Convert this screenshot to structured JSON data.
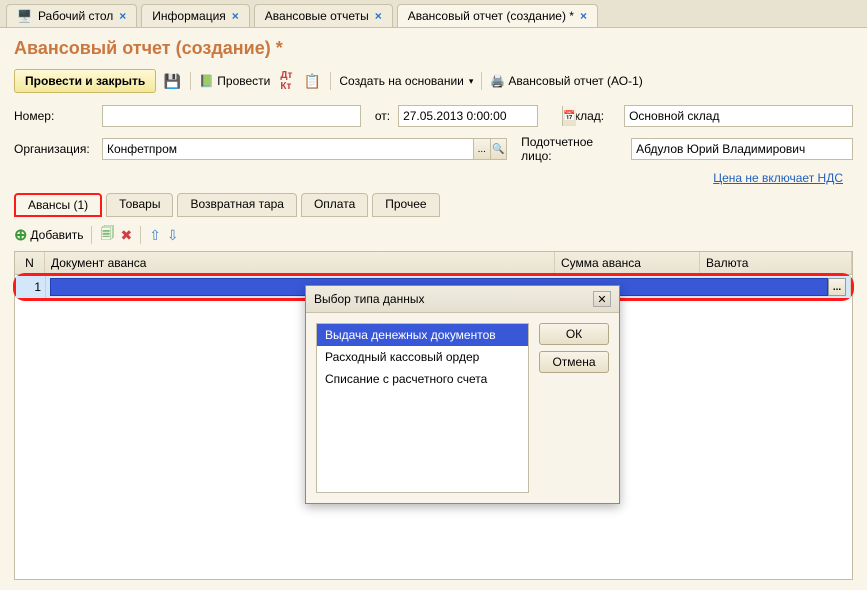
{
  "tabs": [
    {
      "label": "Рабочий стол",
      "active": false
    },
    {
      "label": "Информация",
      "active": false
    },
    {
      "label": "Авансовые отчеты",
      "active": false
    },
    {
      "label": "Авансовый отчет (создание) *",
      "active": true
    }
  ],
  "page_title": "Авансовый отчет (создание) *",
  "toolbar": {
    "post_close": "Провести и закрыть",
    "post": "Провести",
    "create_based": "Создать на основании",
    "print_form": "Авансовый отчет (АО-1)"
  },
  "form": {
    "number_label": "Номер:",
    "number_value": "",
    "from_label": "от:",
    "date_value": "27.05.2013 0:00:00",
    "warehouse_label": "Склад:",
    "warehouse_value": "Основной склад",
    "org_label": "Организация:",
    "org_value": "Конфетпром",
    "person_label": "Подотчетное лицо:",
    "person_value": "Абдулов Юрий Владимирович",
    "vat_link": "Цена не включает НДС"
  },
  "inner_tabs": [
    {
      "label": "Авансы (1)",
      "highlighted": true
    },
    {
      "label": "Товары"
    },
    {
      "label": "Возвратная тара"
    },
    {
      "label": "Оплата"
    },
    {
      "label": "Прочее"
    }
  ],
  "sub_toolbar": {
    "add": "Добавить"
  },
  "grid": {
    "headers": {
      "n": "N",
      "doc": "Документ аванса",
      "sum": "Сумма аванса",
      "val": "Валюта"
    },
    "row": {
      "n": "1",
      "doc": ""
    }
  },
  "dialog": {
    "title": "Выбор типа данных",
    "options": [
      {
        "label": "Выдача денежных документов",
        "selected": true
      },
      {
        "label": "Расходный кассовый ордер",
        "selected": false
      },
      {
        "label": "Списание с расчетного счета",
        "selected": false
      }
    ],
    "ok": "ОК",
    "cancel": "Отмена"
  }
}
